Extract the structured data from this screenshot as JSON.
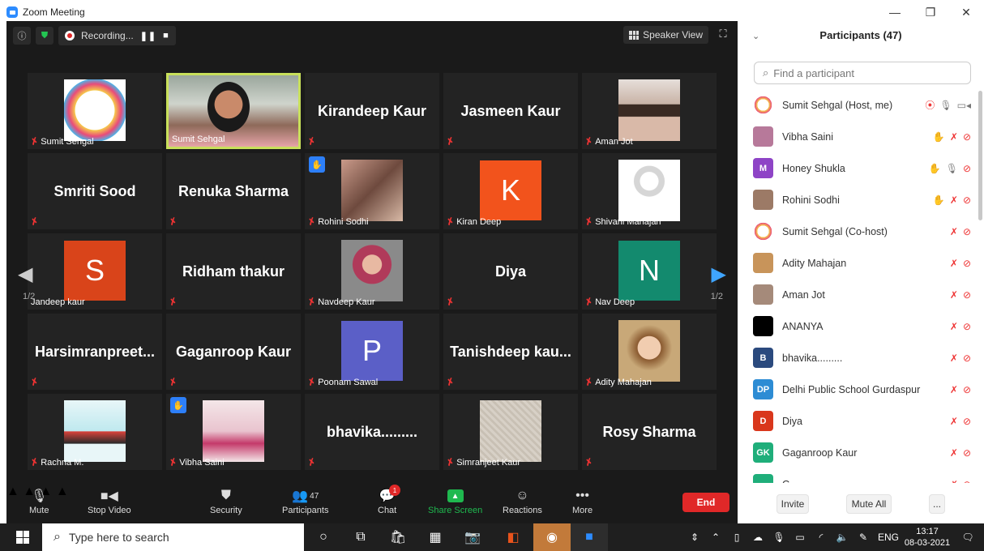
{
  "window": {
    "title": "Zoom Meeting",
    "minimize": "—",
    "restore": "❐",
    "close": "✕"
  },
  "topbar": {
    "recording_label": "Recording...",
    "pause": "❚❚",
    "stop": "■",
    "speaker_view": "Speaker View"
  },
  "tiles": [
    {
      "type": "image",
      "img": "club",
      "label": "Sumit Sehgal",
      "muted": true
    },
    {
      "type": "video",
      "label": "Sumit Sehgal",
      "muted": false,
      "active": true
    },
    {
      "type": "name",
      "name": "Kirandeep Kaur",
      "muted": true
    },
    {
      "type": "name",
      "name": "Jasmeen Kaur",
      "muted": true
    },
    {
      "type": "image",
      "img": "person",
      "label": "Aman Jot",
      "muted": true
    },
    {
      "type": "name",
      "name": "Smriti Sood",
      "muted": true
    },
    {
      "type": "name",
      "name": "Renuka Sharma",
      "muted": true
    },
    {
      "type": "image",
      "img": "kids",
      "label": "Rohini Sodhi",
      "muted": true,
      "hand": true
    },
    {
      "type": "letter",
      "letter": "K",
      "color": "#f2531c",
      "label": "Kiran Deep",
      "muted": true
    },
    {
      "type": "image",
      "img": "silhouette",
      "label": "Shivani Mahajan",
      "muted": true
    },
    {
      "type": "letter",
      "letter": "S",
      "color": "#d9441a",
      "label": "Jandeep kaur",
      "muted": false
    },
    {
      "type": "name",
      "name": "Ridham thakur",
      "muted": true
    },
    {
      "type": "image",
      "img": "woman",
      "label": "Navdeep Kaur",
      "muted": true
    },
    {
      "type": "name",
      "name": "Diya",
      "muted": true
    },
    {
      "type": "letter",
      "letter": "N",
      "color": "#138a6e",
      "label": "Nav Deep",
      "muted": true
    },
    {
      "type": "name",
      "name": "Harsimranpreet...",
      "muted": true
    },
    {
      "type": "name",
      "name": "Gaganroop Kaur",
      "muted": true
    },
    {
      "type": "letter",
      "letter": "P",
      "color": "#5b5fc7",
      "label": "Poonam Sawal",
      "muted": true
    },
    {
      "type": "name",
      "name": "Tanishdeep kau...",
      "muted": true
    },
    {
      "type": "image",
      "img": "boy",
      "label": "Adity Mahajan",
      "muted": true
    },
    {
      "type": "image",
      "img": "poster",
      "label": "Rachna M.",
      "muted": true
    },
    {
      "type": "image",
      "img": "girl",
      "label": "Vibha Saini",
      "muted": true,
      "hand": true
    },
    {
      "type": "name",
      "name": "bhavika.........",
      "muted": true
    },
    {
      "type": "image",
      "img": "sketch",
      "label": "Simranjeet Kaur",
      "muted": true
    },
    {
      "type": "name",
      "name": "Rosy Sharma",
      "muted": true
    }
  ],
  "paging": {
    "left": "1/2",
    "right": "1/2"
  },
  "toolbar": {
    "mute": "Mute",
    "stop_video": "Stop Video",
    "security": "Security",
    "participants": "Participants",
    "participants_count": "47",
    "chat": "Chat",
    "chat_badge": "1",
    "share_screen": "Share Screen",
    "reactions": "Reactions",
    "more": "More",
    "end": "End"
  },
  "panel": {
    "title": "Participants (47)",
    "search_placeholder": "Find a participant",
    "participants": [
      {
        "name": "Sumit Sehgal (Host, me)",
        "avatar": "img",
        "av_color": "#f5e9c8",
        "icons": [
          "rec",
          "mic",
          "cam"
        ]
      },
      {
        "name": "Vibha Saini",
        "avatar": "img",
        "av_color": "#b7799a",
        "icons": [
          "hand",
          "mute",
          "camoff"
        ]
      },
      {
        "name": "Honey Shukla",
        "avatar": "M",
        "av_color": "#8e44c6",
        "icons": [
          "hand",
          "mic",
          "camoff"
        ]
      },
      {
        "name": "Rohini Sodhi",
        "avatar": "img",
        "av_color": "#9c7a66",
        "icons": [
          "hand",
          "mute",
          "camoff"
        ]
      },
      {
        "name": "Sumit Sehgal (Co-host)",
        "avatar": "img",
        "av_color": "#f5e9c8",
        "icons": [
          "mute",
          "camoff"
        ]
      },
      {
        "name": "Adity Mahajan",
        "avatar": "img",
        "av_color": "#c8945a",
        "icons": [
          "mute",
          "camoff"
        ]
      },
      {
        "name": "Aman Jot",
        "avatar": "img",
        "av_color": "#a58a7a",
        "icons": [
          "mute",
          "camoff"
        ]
      },
      {
        "name": "ANANYA",
        "avatar": "",
        "av_color": "#000000",
        "icons": [
          "mute",
          "camoff"
        ]
      },
      {
        "name": "bhavika.........",
        "avatar": "B",
        "av_color": "#2b4a7e",
        "icons": [
          "mute",
          "camoff"
        ]
      },
      {
        "name": "Delhi Public School Gurdaspur",
        "avatar": "DP",
        "av_color": "#2d8cd4",
        "icons": [
          "mute",
          "camoff"
        ]
      },
      {
        "name": "Diya",
        "avatar": "D",
        "av_color": "#d9371c",
        "icons": [
          "mute",
          "camoff"
        ]
      },
      {
        "name": "Gaganroop Kaur",
        "avatar": "GK",
        "av_color": "#1fae7a",
        "icons": [
          "mute",
          "camoff"
        ]
      },
      {
        "name": "G...",
        "avatar": "",
        "av_color": "#1fae7a",
        "icons": [
          "mute",
          "camoff"
        ]
      }
    ],
    "invite": "Invite",
    "mute_all": "Mute All",
    "more": "..."
  },
  "taskbar": {
    "search_placeholder": "Type here to search",
    "language": "ENG",
    "time": "13:17",
    "date": "08-03-2021"
  }
}
